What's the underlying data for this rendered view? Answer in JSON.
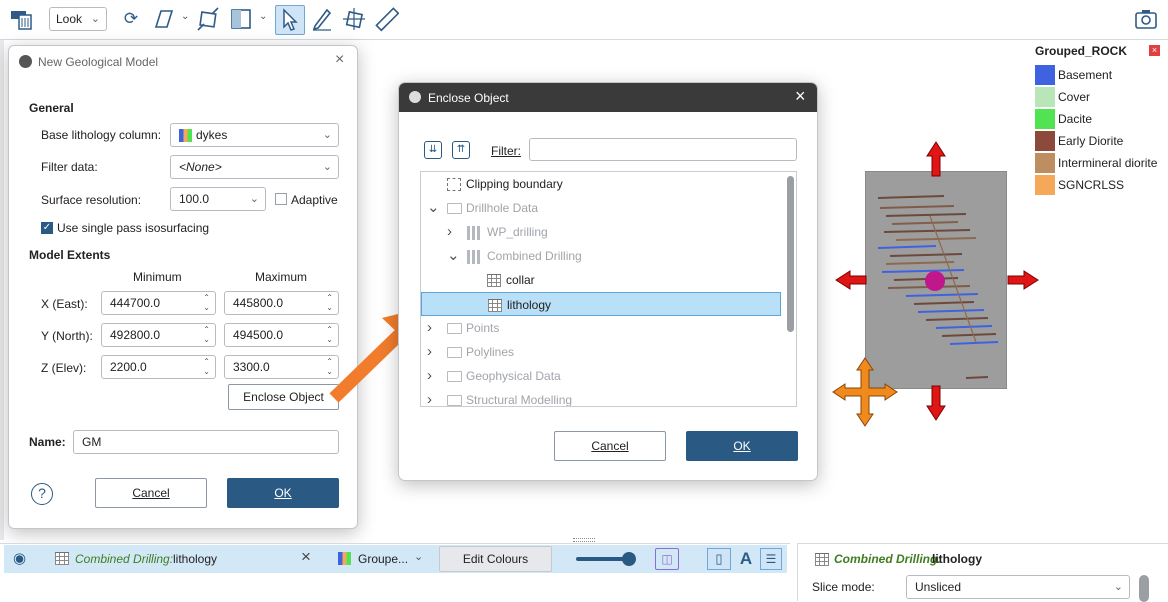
{
  "toolbar": {
    "view_mode": "Look",
    "icons": [
      "tray-icon",
      "rotate-icon",
      "draw-plane-icon",
      "resize-icon",
      "panel-icon",
      "select-pointer-icon",
      "pencil-icon",
      "move-object-icon",
      "ruler-icon",
      "camera-icon"
    ]
  },
  "new_model_dialog": {
    "title": "New Geological Model",
    "general_heading": "General",
    "base_lithology_label": "Base lithology column:",
    "base_lithology_value": "dykes",
    "filter_label": "Filter data:",
    "filter_value": "<None>",
    "surface_res_label": "Surface resolution:",
    "surface_res_value": "100.0",
    "adaptive_label": "Adaptive",
    "single_pass_label": "Use single pass isosurfacing",
    "extents_heading": "Model Extents",
    "col_minimum": "Minimum",
    "col_maximum": "Maximum",
    "extents": [
      {
        "label": "X (East):",
        "min": "444700.0",
        "max": "445800.0"
      },
      {
        "label": "Y (North):",
        "min": "492800.0",
        "max": "494500.0"
      },
      {
        "label": "Z (Elev):",
        "min": "2200.0",
        "max": "3300.0"
      }
    ],
    "enclose_button": "Enclose Object",
    "name_label": "Name:",
    "name_value": "GM",
    "help": "?",
    "cancel": "Cancel",
    "ok": "OK"
  },
  "enclose_dialog": {
    "title": "Enclose Object",
    "filter_label": "Filter:",
    "filter_value": "",
    "tree": [
      {
        "label": "Clipping boundary",
        "indent": 0,
        "muted": false
      },
      {
        "label": "Drillhole Data",
        "indent": 0,
        "muted": true,
        "expanded": true
      },
      {
        "label": "WP_drilling",
        "indent": 1,
        "muted": true,
        "expanded": false
      },
      {
        "label": "Combined Drilling",
        "indent": 1,
        "muted": true,
        "expanded": true
      },
      {
        "label": "collar",
        "indent": 2,
        "muted": false
      },
      {
        "label": "lithology",
        "indent": 2,
        "muted": false,
        "selected": true
      },
      {
        "label": "Points",
        "indent": 0,
        "muted": true
      },
      {
        "label": "Polylines",
        "indent": 0,
        "muted": true
      },
      {
        "label": "Geophysical Data",
        "indent": 0,
        "muted": true
      },
      {
        "label": "Structural Modelling",
        "indent": 0,
        "muted": true
      }
    ],
    "cancel": "Cancel",
    "ok": "OK"
  },
  "legend": {
    "title": "Grouped_ROCK",
    "items": [
      {
        "label": "Basement",
        "color": "#3f63e0"
      },
      {
        "label": "Cover",
        "color": "#b9e6b8"
      },
      {
        "label": "Dacite",
        "color": "#52e352"
      },
      {
        "label": "Early Diorite",
        "color": "#8c4a3c"
      },
      {
        "label": "Intermineral diorite",
        "color": "#bd8e5f"
      },
      {
        "label": "SGNCRLSS",
        "color": "#f5a85a"
      }
    ]
  },
  "bottom_bar": {
    "object_source": "Combined Drilling:",
    "object_name": "lithology",
    "colour_column": "Groupe...",
    "edit_colours": "Edit Colours",
    "slider_level": 0.95
  },
  "properties_panel": {
    "object_source": "Combined Drilling:",
    "object_name": "lithology",
    "slice_label": "Slice mode:",
    "slice_value": "Unsliced"
  },
  "colors": {
    "accent": "#2a5a83",
    "selection": "#a9dbf6",
    "arrow": "#f07c2c"
  }
}
